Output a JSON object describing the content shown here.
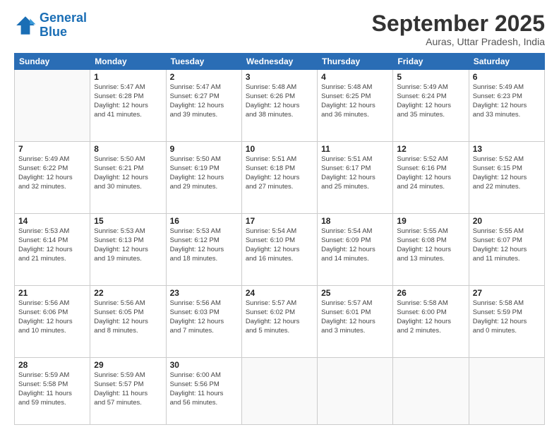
{
  "header": {
    "logo_line1": "General",
    "logo_line2": "Blue",
    "title": "September 2025",
    "subtitle": "Auras, Uttar Pradesh, India"
  },
  "weekdays": [
    "Sunday",
    "Monday",
    "Tuesday",
    "Wednesday",
    "Thursday",
    "Friday",
    "Saturday"
  ],
  "weeks": [
    [
      {
        "day": "",
        "info": ""
      },
      {
        "day": "1",
        "info": "Sunrise: 5:47 AM\nSunset: 6:28 PM\nDaylight: 12 hours\nand 41 minutes."
      },
      {
        "day": "2",
        "info": "Sunrise: 5:47 AM\nSunset: 6:27 PM\nDaylight: 12 hours\nand 39 minutes."
      },
      {
        "day": "3",
        "info": "Sunrise: 5:48 AM\nSunset: 6:26 PM\nDaylight: 12 hours\nand 38 minutes."
      },
      {
        "day": "4",
        "info": "Sunrise: 5:48 AM\nSunset: 6:25 PM\nDaylight: 12 hours\nand 36 minutes."
      },
      {
        "day": "5",
        "info": "Sunrise: 5:49 AM\nSunset: 6:24 PM\nDaylight: 12 hours\nand 35 minutes."
      },
      {
        "day": "6",
        "info": "Sunrise: 5:49 AM\nSunset: 6:23 PM\nDaylight: 12 hours\nand 33 minutes."
      }
    ],
    [
      {
        "day": "7",
        "info": "Sunrise: 5:49 AM\nSunset: 6:22 PM\nDaylight: 12 hours\nand 32 minutes."
      },
      {
        "day": "8",
        "info": "Sunrise: 5:50 AM\nSunset: 6:21 PM\nDaylight: 12 hours\nand 30 minutes."
      },
      {
        "day": "9",
        "info": "Sunrise: 5:50 AM\nSunset: 6:19 PM\nDaylight: 12 hours\nand 29 minutes."
      },
      {
        "day": "10",
        "info": "Sunrise: 5:51 AM\nSunset: 6:18 PM\nDaylight: 12 hours\nand 27 minutes."
      },
      {
        "day": "11",
        "info": "Sunrise: 5:51 AM\nSunset: 6:17 PM\nDaylight: 12 hours\nand 25 minutes."
      },
      {
        "day": "12",
        "info": "Sunrise: 5:52 AM\nSunset: 6:16 PM\nDaylight: 12 hours\nand 24 minutes."
      },
      {
        "day": "13",
        "info": "Sunrise: 5:52 AM\nSunset: 6:15 PM\nDaylight: 12 hours\nand 22 minutes."
      }
    ],
    [
      {
        "day": "14",
        "info": "Sunrise: 5:53 AM\nSunset: 6:14 PM\nDaylight: 12 hours\nand 21 minutes."
      },
      {
        "day": "15",
        "info": "Sunrise: 5:53 AM\nSunset: 6:13 PM\nDaylight: 12 hours\nand 19 minutes."
      },
      {
        "day": "16",
        "info": "Sunrise: 5:53 AM\nSunset: 6:12 PM\nDaylight: 12 hours\nand 18 minutes."
      },
      {
        "day": "17",
        "info": "Sunrise: 5:54 AM\nSunset: 6:10 PM\nDaylight: 12 hours\nand 16 minutes."
      },
      {
        "day": "18",
        "info": "Sunrise: 5:54 AM\nSunset: 6:09 PM\nDaylight: 12 hours\nand 14 minutes."
      },
      {
        "day": "19",
        "info": "Sunrise: 5:55 AM\nSunset: 6:08 PM\nDaylight: 12 hours\nand 13 minutes."
      },
      {
        "day": "20",
        "info": "Sunrise: 5:55 AM\nSunset: 6:07 PM\nDaylight: 12 hours\nand 11 minutes."
      }
    ],
    [
      {
        "day": "21",
        "info": "Sunrise: 5:56 AM\nSunset: 6:06 PM\nDaylight: 12 hours\nand 10 minutes."
      },
      {
        "day": "22",
        "info": "Sunrise: 5:56 AM\nSunset: 6:05 PM\nDaylight: 12 hours\nand 8 minutes."
      },
      {
        "day": "23",
        "info": "Sunrise: 5:56 AM\nSunset: 6:03 PM\nDaylight: 12 hours\nand 7 minutes."
      },
      {
        "day": "24",
        "info": "Sunrise: 5:57 AM\nSunset: 6:02 PM\nDaylight: 12 hours\nand 5 minutes."
      },
      {
        "day": "25",
        "info": "Sunrise: 5:57 AM\nSunset: 6:01 PM\nDaylight: 12 hours\nand 3 minutes."
      },
      {
        "day": "26",
        "info": "Sunrise: 5:58 AM\nSunset: 6:00 PM\nDaylight: 12 hours\nand 2 minutes."
      },
      {
        "day": "27",
        "info": "Sunrise: 5:58 AM\nSunset: 5:59 PM\nDaylight: 12 hours\nand 0 minutes."
      }
    ],
    [
      {
        "day": "28",
        "info": "Sunrise: 5:59 AM\nSunset: 5:58 PM\nDaylight: 11 hours\nand 59 minutes."
      },
      {
        "day": "29",
        "info": "Sunrise: 5:59 AM\nSunset: 5:57 PM\nDaylight: 11 hours\nand 57 minutes."
      },
      {
        "day": "30",
        "info": "Sunrise: 6:00 AM\nSunset: 5:56 PM\nDaylight: 11 hours\nand 56 minutes."
      },
      {
        "day": "",
        "info": ""
      },
      {
        "day": "",
        "info": ""
      },
      {
        "day": "",
        "info": ""
      },
      {
        "day": "",
        "info": ""
      }
    ]
  ]
}
